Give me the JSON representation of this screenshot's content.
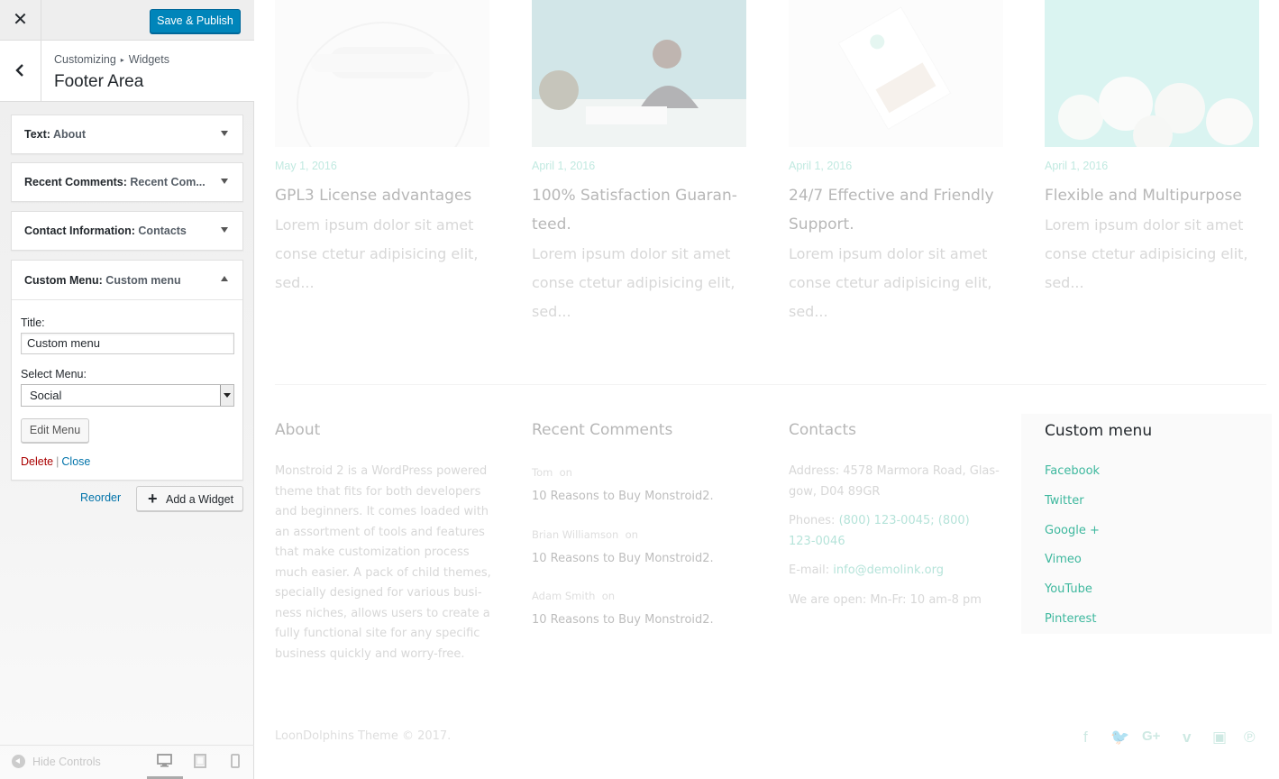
{
  "topbar": {
    "close_icon": "close-icon",
    "publish_label": "Save & Publish"
  },
  "section": {
    "crumb_root": "Customizing",
    "crumb_child": "Widgets",
    "title": "Footer Area"
  },
  "widgets": [
    {
      "type": "Text:",
      "instance": "About"
    },
    {
      "type": "Recent Comments:",
      "instance": "Recent Com..."
    },
    {
      "type": "Contact Information:",
      "instance": "Contacts"
    },
    {
      "type": "Custom Menu:",
      "instance": "Custom menu"
    }
  ],
  "custom_menu_form": {
    "title_label": "Title:",
    "title_value": "Custom menu",
    "select_label": "Select Menu:",
    "select_value": "Social",
    "edit_button": "Edit Menu",
    "delete_link": "Delete",
    "separator": "|",
    "close_link": "Close"
  },
  "actions": {
    "reorder": "Reorder",
    "add_widget": "Add a Widget"
  },
  "footer_controls": {
    "hide_controls": "Hide Controls",
    "devices": [
      "desktop",
      "tablet",
      "mobile"
    ]
  },
  "preview": {
    "posts": [
      {
        "date": "May 1, 2016",
        "title_lines": [
          "GPL3 License advantages"
        ],
        "excerpt_lines": [
          "Lorem ipsum dolor sit amet",
          "conse ctetur adipisicing elit,",
          "sed..."
        ]
      },
      {
        "date": "April 1, 2016",
        "title_lines": [
          "100% Satisfaction Guaran-",
          "teed."
        ],
        "excerpt_lines": [
          "Lorem ipsum dolor sit amet",
          "conse ctetur adipisicing elit,",
          "sed..."
        ]
      },
      {
        "date": "April 1, 2016",
        "title_lines": [
          "24/7 Effective and Friendly",
          "Support."
        ],
        "excerpt_lines": [
          "Lorem ipsum dolor sit amet",
          "conse ctetur adipisicing elit,",
          "sed..."
        ]
      },
      {
        "date": "April 1, 2016",
        "title_lines": [
          "Flexible and Multipurpose"
        ],
        "excerpt_lines": [
          "Lorem ipsum dolor sit amet",
          "conse ctetur adipisicing elit,",
          "sed..."
        ]
      }
    ],
    "about": {
      "heading": "About",
      "lines": [
        "Monstroid 2 is a WordPress powered",
        "theme that fits for both developers",
        "and beginners. It comes loaded with",
        "an assortment of tools and features",
        "that make customization process",
        "much easier. A pack of child themes,",
        "specially designed for various busi-",
        "ness niches, allows users to create a",
        "fully functional site for any specific",
        "business quickly and worry-free."
      ]
    },
    "recent_comments": {
      "heading": "Recent Comments",
      "items": [
        {
          "author": "Tom",
          "on": "on",
          "post": "10 Reasons to Buy Monstroid2."
        },
        {
          "author": "Brian Williamson",
          "on": "on",
          "post": "10 Reasons to Buy Monstroid2."
        },
        {
          "author": "Adam Smith",
          "on": "on",
          "post": "10 Reasons to Buy Monstroid2."
        }
      ]
    },
    "contacts": {
      "heading": "Contacts",
      "address_lines": [
        "Address: 4578 Marmora Road, Glas-",
        "gow, D04 89GR"
      ],
      "phones_label": "Phones:",
      "phones_lines": [
        "(800) 123-0045; (800)",
        "123-0046"
      ],
      "email_label": "E-mail:",
      "email": "info@demolink.org",
      "hours": "We are open: Mn-Fr: 10 am-8 pm"
    },
    "custom_menu": {
      "heading": "Custom menu",
      "items": [
        "Facebook",
        "Twitter",
        "Google +",
        "Vimeo",
        "YouTube",
        "Pinterest"
      ]
    },
    "copyright": "LoonDolphins Theme © 2017.",
    "social_icons": [
      "facebook-icon",
      "twitter-icon",
      "google-plus-icon",
      "vimeo-icon",
      "youtube-icon",
      "pinterest-icon"
    ]
  }
}
